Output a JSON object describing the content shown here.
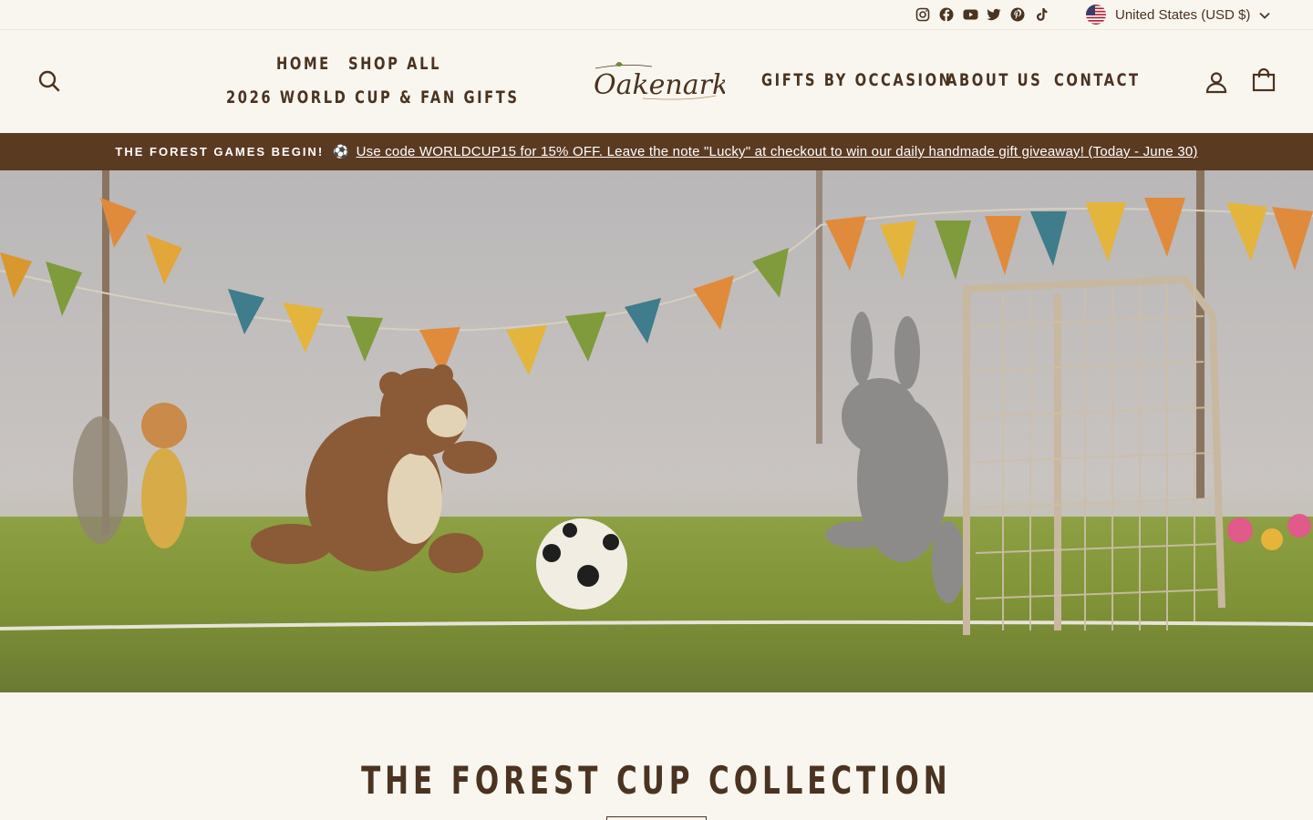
{
  "utility": {
    "social_icons": [
      "instagram-icon",
      "facebook-icon",
      "youtube-icon",
      "twitter-icon",
      "pinterest-icon",
      "tiktok-icon"
    ],
    "currency": "United States (USD $)"
  },
  "nav": {
    "home": "HOME",
    "shop_all": "SHOP ALL",
    "world_cup": "2026 WORLD CUP & FAN GIFTS",
    "gifts": "GIFTS BY OCCASION",
    "about": "ABOUT US",
    "contact": "CONTACT"
  },
  "brand": {
    "name": "Oakenark"
  },
  "announcement": {
    "lead": "THE FOREST GAMES BEGIN!",
    "icon": "⚽",
    "link": "Use code WORLDCUP15 for 15% OFF. Leave the note \"Lucky\" at checkout to win our daily handmade gift giveaway! (Today - June 30)"
  },
  "collection": {
    "title": "THE FOREST CUP COLLECTION"
  },
  "colors": {
    "background": "#f9f6f0",
    "text": "#4a3320",
    "announcement_bg": "#5b3a22"
  }
}
